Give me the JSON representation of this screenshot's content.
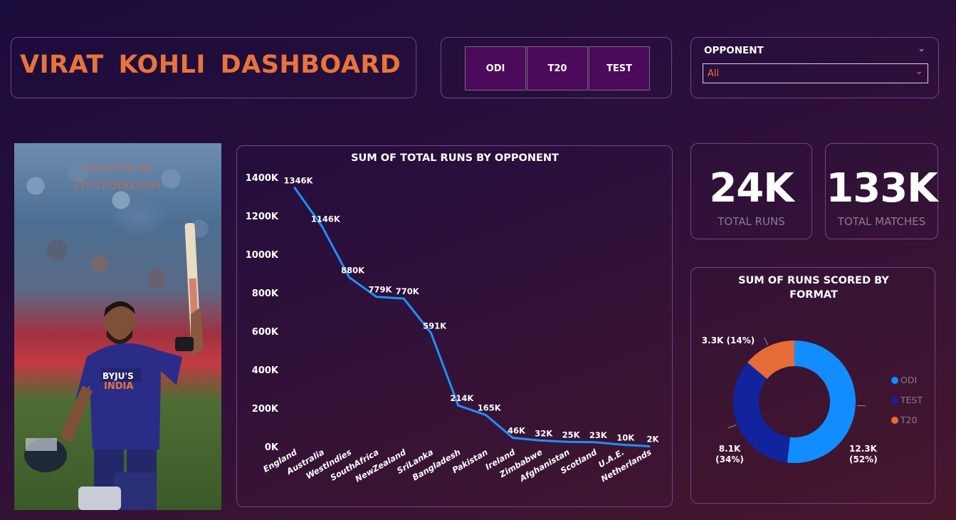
{
  "dashboard": {
    "title": "VIRAT  KOHLI  DASHBOARD",
    "format_buttons": [
      "ODI",
      "T20",
      "TEST"
    ],
    "slicer": {
      "title": "OPPONENT",
      "selected": "All"
    },
    "photo_watermark": [
      "CREATED BY",
      "JYOTIPRAKASH"
    ]
  },
  "kpis": {
    "total_runs": {
      "value": "24K",
      "label": "TOTAL RUNS"
    },
    "total_matches": {
      "value": "133K",
      "label": "TOTAL MATCHES"
    }
  },
  "colors": {
    "accent": "#e8743b",
    "line": "#1e90ff",
    "odi": "#118dff",
    "test": "#12239e",
    "t20": "#e66c37"
  },
  "chart_data": [
    {
      "type": "line",
      "title": "SUM OF TOTAL RUNS BY OPPONENT",
      "categories": [
        "England",
        "Australia",
        "WestIndies",
        "SouthAfrica",
        "NewZealand",
        "SriLanka",
        "Bangladesh",
        "Pakistan",
        "Ireland",
        "Zimbabwe",
        "Afghanistan",
        "Scotland",
        "U.A.E.",
        "Netherlands"
      ],
      "values": [
        1346,
        1146,
        880,
        779,
        770,
        591,
        214,
        165,
        46,
        32,
        25,
        23,
        10,
        2
      ],
      "data_labels": [
        "1346K",
        "1146K",
        "880K",
        "779K",
        "770K",
        "591K",
        "214K",
        "165K",
        "46K",
        "32K",
        "25K",
        "23K",
        "10K",
        "2K"
      ],
      "yticks": [
        0,
        200,
        400,
        600,
        800,
        1000,
        1200,
        1400
      ],
      "ytick_labels": [
        "0K",
        "200K",
        "400K",
        "600K",
        "800K",
        "1000K",
        "1200K",
        "1400K"
      ],
      "ylim": [
        0,
        1400
      ],
      "grid": false
    },
    {
      "type": "pie",
      "title": [
        "SUM OF RUNS SCORED BY",
        "FORMAT"
      ],
      "donut": true,
      "slices": [
        {
          "name": "ODI",
          "value": 12.3,
          "label": [
            "12.3K",
            "(52%)"
          ]
        },
        {
          "name": "TEST",
          "value": 8.1,
          "label": [
            "8.1K",
            "(34%)"
          ]
        },
        {
          "name": "T20",
          "value": 3.3,
          "label": [
            "3.3K (14%)"
          ]
        }
      ],
      "legend": [
        "ODI",
        "TEST",
        "T20"
      ],
      "legend_position": "right"
    }
  ]
}
